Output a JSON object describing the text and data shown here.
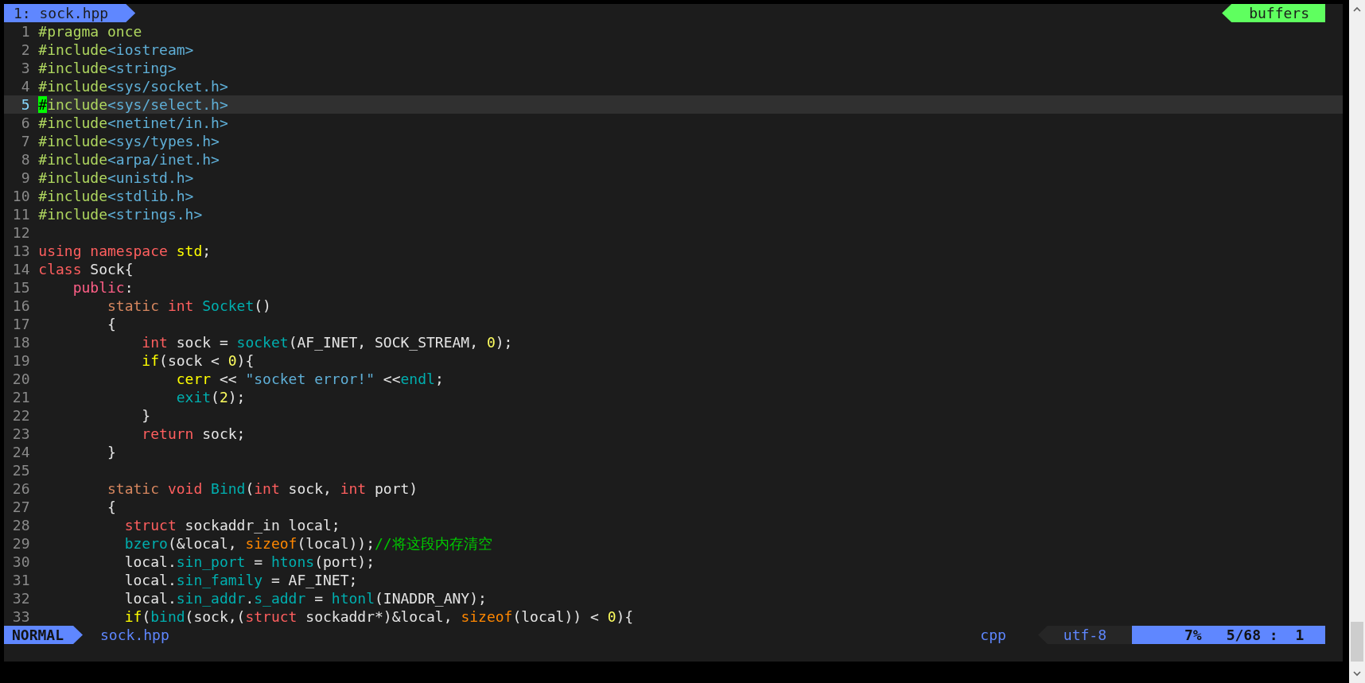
{
  "tabline": {
    "tabs": [
      {
        "label": "1: sock.hpp",
        "selected": true
      }
    ],
    "buffers_label": "buffers"
  },
  "lines": [
    {
      "number": "1",
      "current": false,
      "tokens": [
        {
          "text": "#pragma once",
          "kind": "preproc"
        }
      ]
    },
    {
      "number": "2",
      "current": false,
      "tokens": [
        {
          "text": "#include",
          "kind": "preproc"
        },
        {
          "text": "<iostream>",
          "kind": "include"
        }
      ]
    },
    {
      "number": "3",
      "current": false,
      "tokens": [
        {
          "text": "#include",
          "kind": "preproc"
        },
        {
          "text": "<string>",
          "kind": "include"
        }
      ]
    },
    {
      "number": "4",
      "current": false,
      "tokens": [
        {
          "text": "#include",
          "kind": "preproc"
        },
        {
          "text": "<sys/socket.h>",
          "kind": "include"
        }
      ]
    },
    {
      "number": "5",
      "current": true,
      "tokens": [
        {
          "text": "#",
          "kind": "cursor"
        },
        {
          "text": "include",
          "kind": "preproc"
        },
        {
          "text": "<sys/select.h>",
          "kind": "include"
        }
      ]
    },
    {
      "number": "6",
      "current": false,
      "tokens": [
        {
          "text": "#include",
          "kind": "preproc"
        },
        {
          "text": "<netinet/in.h>",
          "kind": "include"
        }
      ]
    },
    {
      "number": "7",
      "current": false,
      "tokens": [
        {
          "text": "#include",
          "kind": "preproc"
        },
        {
          "text": "<sys/types.h>",
          "kind": "include"
        }
      ]
    },
    {
      "number": "8",
      "current": false,
      "tokens": [
        {
          "text": "#include",
          "kind": "preproc"
        },
        {
          "text": "<arpa/inet.h>",
          "kind": "include"
        }
      ]
    },
    {
      "number": "9",
      "current": false,
      "tokens": [
        {
          "text": "#include",
          "kind": "preproc"
        },
        {
          "text": "<unistd.h>",
          "kind": "include"
        }
      ]
    },
    {
      "number": "10",
      "current": false,
      "tokens": [
        {
          "text": "#include",
          "kind": "preproc"
        },
        {
          "text": "<stdlib.h>",
          "kind": "include"
        }
      ]
    },
    {
      "number": "11",
      "current": false,
      "tokens": [
        {
          "text": "#include",
          "kind": "preproc"
        },
        {
          "text": "<strings.h>",
          "kind": "include"
        }
      ]
    },
    {
      "number": "12",
      "current": false
    },
    {
      "number": "13",
      "current": false,
      "tokens": [
        {
          "text": "using namespace",
          "kind": "keyword"
        },
        {
          "text": " std",
          "kind": "control"
        },
        {
          "text": ";",
          "kind": "plain"
        }
      ]
    },
    {
      "number": "14",
      "current": false,
      "tokens": [
        {
          "text": "class",
          "kind": "keyword"
        },
        {
          "text": " Sock{",
          "kind": "plain"
        }
      ]
    },
    {
      "number": "15",
      "current": false,
      "tokens": [
        {
          "text": "    public",
          "kind": "access"
        },
        {
          "text": ":",
          "kind": "plain"
        }
      ]
    },
    {
      "number": "16",
      "current": false,
      "tokens": [
        {
          "text": "        static",
          "kind": "storage"
        },
        {
          "text": " int",
          "kind": "keyword"
        },
        {
          "text": " Socket",
          "kind": "function"
        },
        {
          "text": "()",
          "kind": "plain"
        }
      ]
    },
    {
      "number": "17",
      "current": false,
      "tokens": [
        {
          "text": "        {",
          "kind": "plain"
        }
      ]
    },
    {
      "number": "18",
      "current": false,
      "tokens": [
        {
          "text": "            int",
          "kind": "keyword"
        },
        {
          "text": " sock = ",
          "kind": "plain"
        },
        {
          "text": "socket",
          "kind": "function"
        },
        {
          "text": "(AF_INET, SOCK_STREAM, ",
          "kind": "plain"
        },
        {
          "text": "0",
          "kind": "number"
        },
        {
          "text": ");",
          "kind": "plain"
        }
      ]
    },
    {
      "number": "19",
      "current": false,
      "tokens": [
        {
          "text": "            if",
          "kind": "control"
        },
        {
          "text": "(sock < ",
          "kind": "plain"
        },
        {
          "text": "0",
          "kind": "number"
        },
        {
          "text": "){",
          "kind": "plain"
        }
      ]
    },
    {
      "number": "20",
      "current": false,
      "tokens": [
        {
          "text": "                cerr",
          "kind": "control"
        },
        {
          "text": " << ",
          "kind": "plain"
        },
        {
          "text": "\"socket error!\"",
          "kind": "string"
        },
        {
          "text": " <<",
          "kind": "plain"
        },
        {
          "text": "endl",
          "kind": "function"
        },
        {
          "text": ";",
          "kind": "plain"
        }
      ]
    },
    {
      "number": "21",
      "current": false,
      "tokens": [
        {
          "text": "                exit",
          "kind": "function"
        },
        {
          "text": "(",
          "kind": "plain"
        },
        {
          "text": "2",
          "kind": "number"
        },
        {
          "text": ");",
          "kind": "plain"
        }
      ]
    },
    {
      "number": "22",
      "current": false,
      "tokens": [
        {
          "text": "            }",
          "kind": "plain"
        }
      ]
    },
    {
      "number": "23",
      "current": false,
      "tokens": [
        {
          "text": "            return",
          "kind": "keyword"
        },
        {
          "text": " sock;",
          "kind": "plain"
        }
      ]
    },
    {
      "number": "24",
      "current": false,
      "tokens": [
        {
          "text": "        }",
          "kind": "plain"
        }
      ]
    },
    {
      "number": "25",
      "current": false
    },
    {
      "number": "26",
      "current": false,
      "tokens": [
        {
          "text": "        static",
          "kind": "storage"
        },
        {
          "text": " void",
          "kind": "keyword"
        },
        {
          "text": " Bind",
          "kind": "function"
        },
        {
          "text": "(",
          "kind": "plain"
        },
        {
          "text": "int",
          "kind": "keyword"
        },
        {
          "text": " sock, ",
          "kind": "plain"
        },
        {
          "text": "int",
          "kind": "keyword"
        },
        {
          "text": " port)",
          "kind": "plain"
        }
      ]
    },
    {
      "number": "27",
      "current": false,
      "tokens": [
        {
          "text": "        {",
          "kind": "plain"
        }
      ]
    },
    {
      "number": "28",
      "current": false,
      "tokens": [
        {
          "text": "          struct",
          "kind": "keyword"
        },
        {
          "text": " sockaddr_in local;",
          "kind": "plain"
        }
      ]
    },
    {
      "number": "29",
      "current": false,
      "tokens": [
        {
          "text": "          bzero",
          "kind": "function"
        },
        {
          "text": "(&local, ",
          "kind": "plain"
        },
        {
          "text": "sizeof",
          "kind": "operator"
        },
        {
          "text": "(local));",
          "kind": "plain"
        },
        {
          "text": "//将这段内存清空",
          "kind": "comment"
        }
      ]
    },
    {
      "number": "30",
      "current": false,
      "tokens": [
        {
          "text": "          local.",
          "kind": "plain"
        },
        {
          "text": "sin_port",
          "kind": "function"
        },
        {
          "text": " = ",
          "kind": "plain"
        },
        {
          "text": "htons",
          "kind": "function"
        },
        {
          "text": "(port);",
          "kind": "plain"
        }
      ]
    },
    {
      "number": "31",
      "current": false,
      "tokens": [
        {
          "text": "          local.",
          "kind": "plain"
        },
        {
          "text": "sin_family",
          "kind": "function"
        },
        {
          "text": " = AF_INET;",
          "kind": "plain"
        }
      ]
    },
    {
      "number": "32",
      "current": false,
      "tokens": [
        {
          "text": "          local.",
          "kind": "plain"
        },
        {
          "text": "sin_addr",
          "kind": "function"
        },
        {
          "text": ".",
          "kind": "plain"
        },
        {
          "text": "s_addr",
          "kind": "function"
        },
        {
          "text": " = ",
          "kind": "plain"
        },
        {
          "text": "htonl",
          "kind": "function"
        },
        {
          "text": "(INADDR_ANY);",
          "kind": "plain"
        }
      ]
    },
    {
      "number": "33",
      "current": false,
      "tokens": [
        {
          "text": "          if",
          "kind": "control"
        },
        {
          "text": "(",
          "kind": "plain"
        },
        {
          "text": "bind",
          "kind": "function"
        },
        {
          "text": "(sock,(",
          "kind": "plain"
        },
        {
          "text": "struct",
          "kind": "keyword"
        },
        {
          "text": " sockaddr*)&local, ",
          "kind": "plain"
        },
        {
          "text": "sizeof",
          "kind": "operator"
        },
        {
          "text": "(local)) < ",
          "kind": "plain"
        },
        {
          "text": "0",
          "kind": "number"
        },
        {
          "text": "){",
          "kind": "plain"
        }
      ]
    }
  ],
  "status_bar": {
    "mode": "NORMAL",
    "filename": "sock.hpp",
    "filetype": "cpp",
    "encoding": "utf-8",
    "percent": "7%",
    "position": "5/68 :  1"
  }
}
